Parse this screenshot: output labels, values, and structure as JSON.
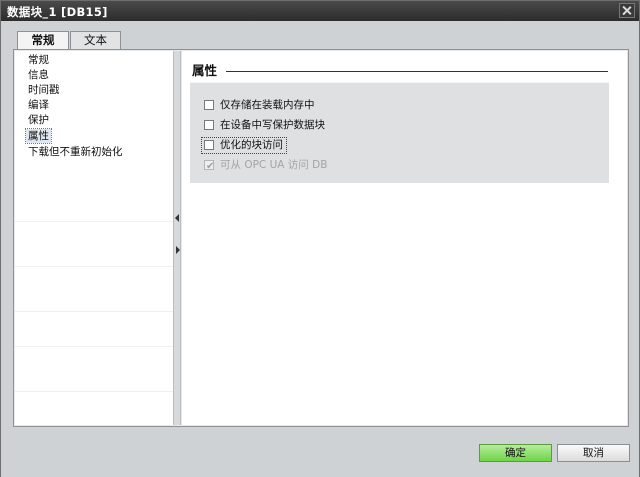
{
  "window": {
    "title": "数据块_1 [DB15]"
  },
  "tabs": [
    {
      "label": "常规",
      "active": true
    },
    {
      "label": "文本",
      "active": false
    }
  ],
  "nav": {
    "items": [
      {
        "label": "常规"
      },
      {
        "label": "信息"
      },
      {
        "label": "时间戳"
      },
      {
        "label": "编译"
      },
      {
        "label": "保护"
      },
      {
        "label": "属性",
        "selected": true
      },
      {
        "label": "下载但不重新初始化"
      }
    ]
  },
  "section": {
    "title": "属性"
  },
  "options": [
    {
      "label": "仅存储在装载内存中",
      "checked": false,
      "enabled": true
    },
    {
      "label": "在设备中写保护数据块",
      "checked": false,
      "enabled": true
    },
    {
      "label": "优化的块访问",
      "checked": false,
      "enabled": true,
      "focused": true
    },
    {
      "label": "可从 OPC UA 访问 DB",
      "checked": true,
      "enabled": false
    }
  ],
  "footer": {
    "ok_label": "确定",
    "cancel_label": "取消"
  },
  "colors": {
    "ok_button": "#6ed447",
    "title_bar": "#2c2c2c",
    "selection": "#dfe7f1"
  }
}
